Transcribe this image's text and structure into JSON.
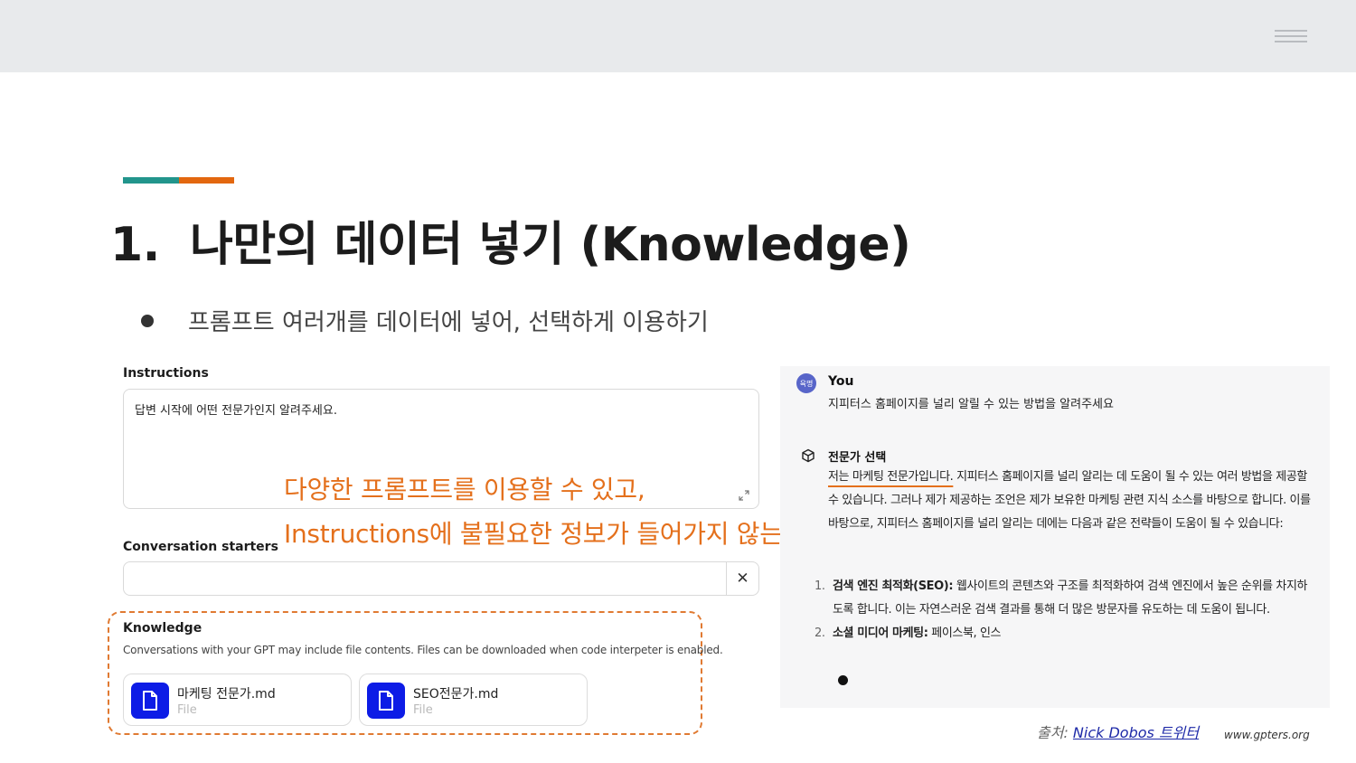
{
  "slide": {
    "number": "1.",
    "title": "나만의 데이터 넣기 (Knowledge)",
    "bullet": "프롬프트 여러개를 데이터에 넣어, 선택하게 이용하기"
  },
  "editor": {
    "instructions_label": "Instructions",
    "instructions_value": "답변 시작에 어떤 전문가인지 알려주세요.",
    "starters_label": "Conversation starters",
    "starter_value": "",
    "starter_remove_glyph": "✕",
    "knowledge_label": "Knowledge",
    "knowledge_desc": "Conversations with your GPT may include file contents. Files can be downloaded when code interpeter is enabled.",
    "files": [
      {
        "name": "마케팅 전문가.md",
        "type": "File"
      },
      {
        "name": "SEO전문가.md",
        "type": "File"
      }
    ]
  },
  "callout": {
    "line1": "다양한 프롬프트를 이용할 수 있고,",
    "line2": "Instructions에 불필요한 정보가 들어가지 않는다."
  },
  "chat": {
    "user_avatar": "육명",
    "user_name": "You",
    "user_message": "지피터스 홈페이지를 널리 알릴 수 있는 방법을 알려주세요",
    "gpt_name": "전문가 선택",
    "answer_highlight": "저는 마케팅 전문가입니다.",
    "answer_rest": " 지피터스 홈페이지를 널리 알리는 데 도움이 될 수 있는 여러 방법을 제공할 수 있습니다. 그러나 제가 제공하는 조언은 제가 보유한 마케팅 관련 지식 소스를 바탕으로 합니다. 이를 바탕으로, 지피터스 홈페이지를 널리 알리는 데에는 다음과 같은 전략들이 도움이 될 수 있습니다:",
    "items": [
      {
        "num": "1.",
        "title": "검색 엔진 최적화(SEO):",
        "text": " 웹사이트의 콘텐츠와 구조를 최적화하여 검색 엔진에서 높은 순위를 차지하도록 합니다. 이는 자연스러운 검색 결과를 통해 더 많은 방문자를 유도하는 데 도움이 됩니다."
      },
      {
        "num": "2.",
        "title": "소셜 미디어 마케팅:",
        "text": " 페이스북, 인스"
      }
    ]
  },
  "footer": {
    "source_prefix": "출처: ",
    "source_link": "Nick Dobos 트위터",
    "site_url": "www.gpters.org"
  },
  "colors": {
    "accent_teal": "#22958c",
    "accent_orange": "#e3670f",
    "callout": "#e4701c",
    "file_icon_bg": "#0d1ce6"
  }
}
